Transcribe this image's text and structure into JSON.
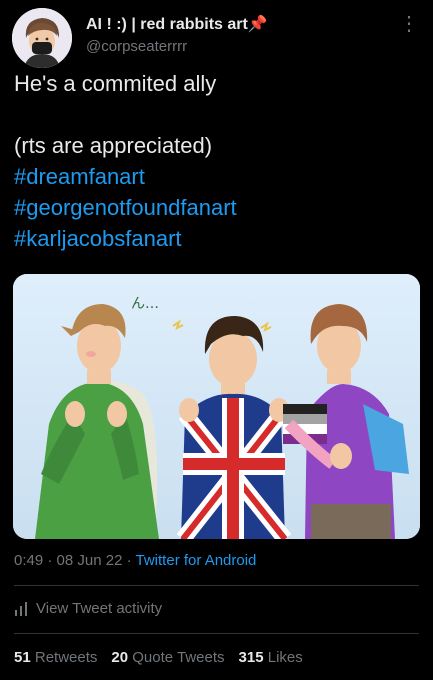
{
  "author": {
    "display_name": "AI ! :) | red rabbits art📌",
    "handle": "@corpseaterrrr"
  },
  "tweet": {
    "lines": [
      "He's a commited ally",
      "",
      "(rts are appreciated)"
    ],
    "hashtags": [
      "#dreamfanart",
      "#georgenotfoundfanart",
      "#karljacobsfanart"
    ]
  },
  "media": {
    "sketch_text": "ん…"
  },
  "meta": {
    "time": "0:49",
    "separator": "·",
    "date": "08 Jun 22",
    "source": "Twitter for Android"
  },
  "activity": {
    "label": "View Tweet activity"
  },
  "stats": {
    "retweets_count": "51",
    "retweets_label": "Retweets",
    "quotes_count": "20",
    "quotes_label": "Quote Tweets",
    "likes_count": "315",
    "likes_label": "Likes"
  },
  "colors": {
    "background": "#000000",
    "accent": "#1d9bf0",
    "muted": "#71767b",
    "text": "#e7e9ea"
  }
}
